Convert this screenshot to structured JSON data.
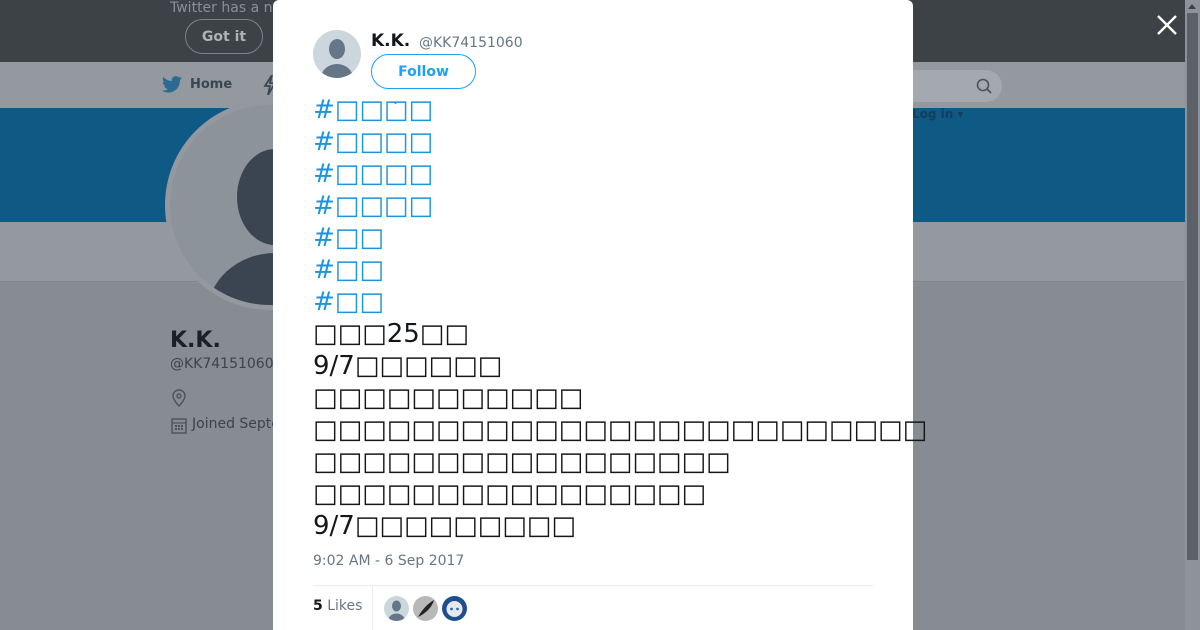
{
  "cookie_bar": {
    "text": "Twitter has a n",
    "got_it_label": "Got it"
  },
  "topnav": {
    "home_label": "Home",
    "login_label": "Log in ▾"
  },
  "profile": {
    "name": "K.K.",
    "handle": "@KK74151060",
    "joined_text": "Joined Septe"
  },
  "tweet": {
    "author_name": "K.K.",
    "author_handle": "@KK74151060",
    "follow_label": "Follow",
    "lines": [
      {
        "text": "#□□□□",
        "hashtag": true
      },
      {
        "text": "#□□□□",
        "hashtag": true
      },
      {
        "text": "#□□□□",
        "hashtag": true
      },
      {
        "text": "#□□□□",
        "hashtag": true
      },
      {
        "text": "#□□",
        "hashtag": true
      },
      {
        "text": "#□□",
        "hashtag": true
      },
      {
        "text": "#□□",
        "hashtag": true
      },
      {
        "text": "□□□25□□",
        "hashtag": false
      },
      {
        "text": "9/7□□□□□□",
        "hashtag": false
      },
      {
        "text": "□□□□□□□□□□□",
        "hashtag": false
      },
      {
        "text": "□□□□□□□□□□□□□□□□□□□□□□□□□",
        "hashtag": false
      },
      {
        "text": "□□□□□□□□□□□□□□□□□",
        "hashtag": false
      },
      {
        "text": "□□□□□□□□□□□□□□□□",
        "hashtag": false
      },
      {
        "text": "9/7□□□□□□□□□",
        "hashtag": false
      }
    ],
    "timestamp": "9:02 AM - 6 Sep 2017",
    "likes_count": "5",
    "likes_label": "Likes"
  },
  "colors": {
    "accent": "#1da1f2",
    "hashtag": "#1b95e0",
    "banner_dimmed": "#0f5a84"
  }
}
